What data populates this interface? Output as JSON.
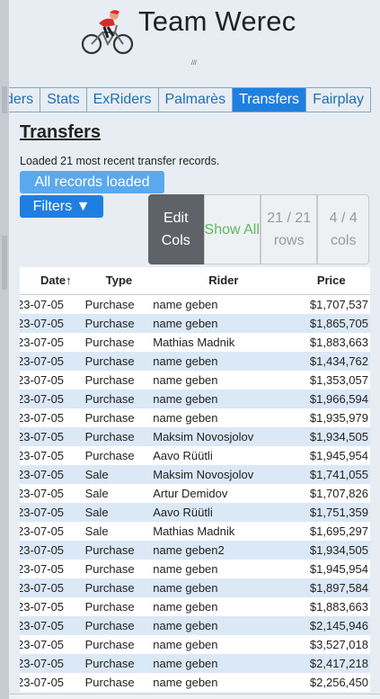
{
  "app": {
    "title": "Team Werec",
    "subtitle": "///"
  },
  "tabs": [
    "ders",
    "Stats",
    "ExRiders",
    "Palmarès",
    "Transfers",
    "Fairplay"
  ],
  "active_tab_index": 4,
  "page": {
    "heading": "Transfers",
    "status": "Loaded 21 most recent transfer records.",
    "badge": "All records loaded",
    "filters_label": "Filters ▼",
    "toggles": {
      "edit": "Edit Cols",
      "show": "Show All",
      "rows": "21 / 21 rows",
      "cols": "4 / 4 cols"
    }
  },
  "table": {
    "headers": [
      "Date↑",
      "Type",
      "Rider",
      "Price"
    ],
    "rows": [
      [
        "23-07-05",
        "Purchase",
        "name geben",
        "$1,707,537"
      ],
      [
        "23-07-05",
        "Purchase",
        "name geben",
        "$1,865,705"
      ],
      [
        "23-07-05",
        "Purchase",
        "Mathias Madnik",
        "$1,883,663"
      ],
      [
        "23-07-05",
        "Purchase",
        "name geben",
        "$1,434,762"
      ],
      [
        "23-07-05",
        "Purchase",
        "name geben",
        "$1,353,057"
      ],
      [
        "23-07-05",
        "Purchase",
        "name geben",
        "$1,966,594"
      ],
      [
        "23-07-05",
        "Purchase",
        "name geben",
        "$1,935,979"
      ],
      [
        "23-07-05",
        "Purchase",
        "Maksim Novosjolov",
        "$1,934,505"
      ],
      [
        "23-07-05",
        "Purchase",
        "Aavo Rüütli",
        "$1,945,954"
      ],
      [
        "23-07-05",
        "Sale",
        "Maksim Novosjolov",
        "$1,741,055"
      ],
      [
        "23-07-05",
        "Sale",
        "Artur Demidov",
        "$1,707,826"
      ],
      [
        "23-07-05",
        "Sale",
        "Aavo Rüütli",
        "$1,751,359"
      ],
      [
        "23-07-05",
        "Sale",
        "Mathias Madnik",
        "$1,695,297"
      ],
      [
        "23-07-05",
        "Purchase",
        "name geben2",
        "$1,934,505"
      ],
      [
        "23-07-05",
        "Purchase",
        "name geben",
        "$1,945,954"
      ],
      [
        "23-07-05",
        "Purchase",
        "name geben",
        "$1,897,584"
      ],
      [
        "23-07-05",
        "Purchase",
        "name geben",
        "$1,883,663"
      ],
      [
        "23-07-05",
        "Purchase",
        "name geben",
        "$2,145,946"
      ],
      [
        "23-07-05",
        "Purchase",
        "name geben",
        "$3,527,018"
      ],
      [
        "23-07-05",
        "Purchase",
        "name geben",
        "$2,417,218"
      ],
      [
        "23-07-05",
        "Purchase",
        "name geben",
        "$2,256,450"
      ]
    ]
  },
  "icons": {
    "logo": "cyclist-icon",
    "sort": "sort-ascending-icon"
  },
  "colors": {
    "accent": "#1f7fe0",
    "tab_border": "#7da8cc",
    "row_alt": "#dbe8f6",
    "show_all": "#5cb85c",
    "edit_bg": "#5f6368"
  }
}
